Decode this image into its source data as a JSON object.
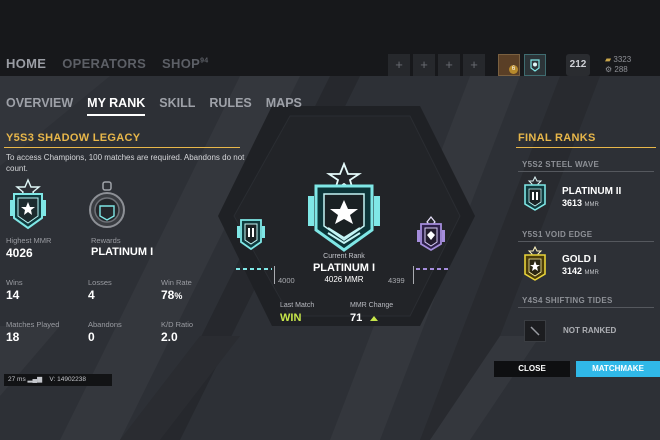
{
  "topbar": {
    "nav": [
      "HOME",
      "OPERATORS",
      "SHOP"
    ],
    "shop_badge": "94",
    "squad_slot_icon": "+",
    "avatar_level": "6",
    "level": "212",
    "currency_renown": "3323",
    "currency_credits": "288"
  },
  "tabs": [
    "OVERVIEW",
    "MY RANK",
    "SKILL",
    "RULES",
    "MAPS"
  ],
  "season": {
    "title": "Y5S3 SHADOW LEGACY",
    "note": "To access Champions, 100 matches are required. Abandons do not count.",
    "highest_mmr_label": "Highest MMR",
    "highest_mmr": "4026",
    "rewards_label": "Rewards",
    "rewards": "PLATINUM I",
    "wins_label": "Wins",
    "wins": "14",
    "losses_label": "Losses",
    "losses": "4",
    "winrate_label": "Win Rate",
    "winrate": "78",
    "winrate_unit": "%",
    "matches_label": "Matches Played",
    "matches": "18",
    "abandons_label": "Abandons",
    "abandons": "0",
    "kd_label": "K/D Ratio",
    "kd": "2.0"
  },
  "netinfo": {
    "ping": "27",
    "ping_unit": "ms",
    "version_prefix": "V:",
    "version": "14902238"
  },
  "current": {
    "label": "Current Rank",
    "rank": "PLATINUM I",
    "mmr": "4026 MMR",
    "range_min": "4000",
    "range_max": "4399",
    "last_match_label": "Last Match",
    "last_match": "WIN",
    "mmr_change_label": "MMR Change",
    "mmr_change": "71"
  },
  "final_ranks": {
    "title": "FINAL RANKS",
    "seasons": [
      {
        "name": "Y5S2 STEEL WAVE",
        "rank": "PLATINUM II",
        "mmr": "3613",
        "unit": "MMR"
      },
      {
        "name": "Y5S1 VOID EDGE",
        "rank": "GOLD I",
        "mmr": "3142",
        "unit": "MMR"
      },
      {
        "name": "Y4S4 SHIFTING TIDES",
        "rank": "NOT RANKED"
      }
    ]
  },
  "buttons": {
    "close": "CLOSE",
    "matchmake": "MATCHMAKE"
  },
  "colors": {
    "accent_gold": "#e8b74a",
    "platinum_teal": "#7fe7e6",
    "diamond_purple": "#a58ddc",
    "gold_yellow": "#e8d33a",
    "win_green": "#c7e64a",
    "matchmake_blue": "#30b8e8"
  }
}
